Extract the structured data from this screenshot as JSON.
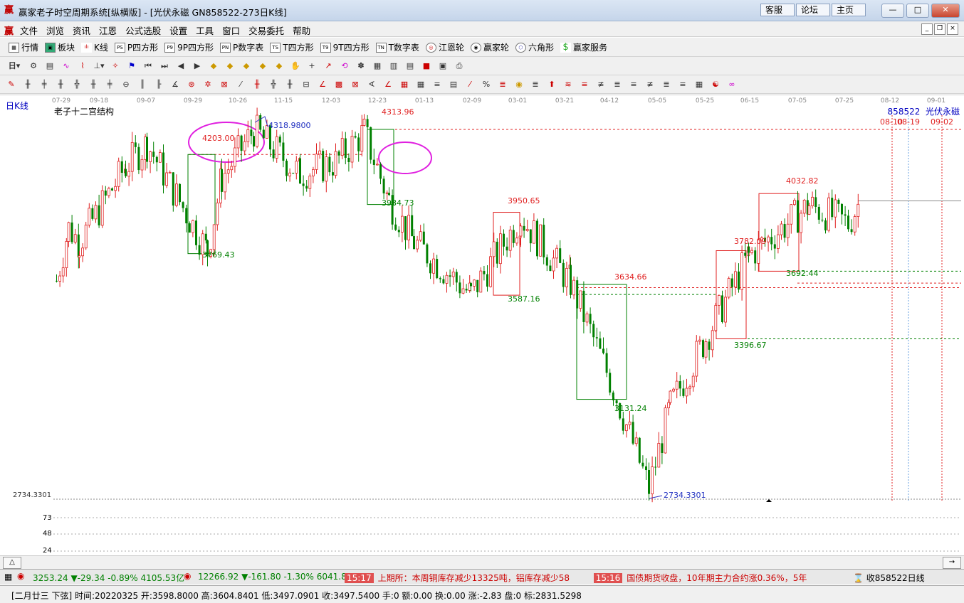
{
  "window": {
    "title": "赢家老子时空周期系统[纵横版] - [光伏永磁  GN858522-273日K线]",
    "links": [
      "客服",
      "论坛",
      "主页"
    ],
    "controls": [
      "—",
      "□",
      "✕"
    ]
  },
  "menu": [
    "文件",
    "浏览",
    "资讯",
    "江恩",
    "公式选股",
    "设置",
    "工具",
    "窗口",
    "交易委托",
    "帮助"
  ],
  "toolbar1": [
    "行情",
    "板块",
    "K线",
    "P四方形",
    "9P四方形",
    "P数字表",
    "T四方形",
    "9T四方形",
    "T数字表",
    "江恩轮",
    "赢家轮",
    "六角形",
    "赢家服务"
  ],
  "toolbar1_icons": [
    "PS",
    "P9",
    "PN",
    "TS",
    "T9",
    "TN"
  ],
  "toolbar2_period": "日",
  "chart": {
    "period_label": "日K线",
    "indicator_label": "老子十二宫结构",
    "symbol_label": "858522  光伏永磁",
    "date_ticks": [
      "07-29",
      "09-18",
      "09-07",
      "09-29",
      "10-26",
      "11-15",
      "12-03",
      "12-23",
      "01-13",
      "02-09",
      "03-01",
      "03-21",
      "04-12",
      "05-05",
      "05-25",
      "06-15",
      "07-05",
      "07-25",
      "08-12",
      "09-01"
    ],
    "future_dates": [
      "08-10",
      "08-19",
      "09-02"
    ],
    "left_price_label": "2734.3301",
    "volume_ticks": [
      "73",
      "48",
      "24"
    ],
    "annotations": [
      {
        "text": "4318.9800",
        "color": "blue"
      },
      {
        "text": "4203.00",
        "color": "red"
      },
      {
        "text": "4313.96",
        "color": "red"
      },
      {
        "text": "3984.73",
        "color": "green"
      },
      {
        "text": "3769.43",
        "color": "green"
      },
      {
        "text": "3950.65",
        "color": "red"
      },
      {
        "text": "3587.16",
        "color": "green"
      },
      {
        "text": "3634.66",
        "color": "red"
      },
      {
        "text": "3131.24",
        "color": "green"
      },
      {
        "text": "2734.3301",
        "color": "blue"
      },
      {
        "text": "3782.09",
        "color": "red"
      },
      {
        "text": "3396.67",
        "color": "green"
      },
      {
        "text": "4032.82",
        "color": "red"
      },
      {
        "text": "3692.44",
        "color": "green"
      }
    ]
  },
  "chart_data": {
    "type": "candlestick",
    "xlabel": "",
    "ylabel": "",
    "ylim": [
      2700,
      4400
    ],
    "x_ticks": [
      "07-29",
      "09-18",
      "09-07",
      "09-29",
      "10-26",
      "11-15",
      "12-03",
      "12-23",
      "01-13",
      "02-09",
      "03-01",
      "03-21",
      "04-12",
      "05-05",
      "05-25",
      "06-15",
      "07-05",
      "07-25",
      "08-12",
      "09-01"
    ],
    "close_path": [
      {
        "x": "07-29",
        "y": 3650
      },
      {
        "x": "08-10",
        "y": 3880
      },
      {
        "x": "08-25",
        "y": 3820
      },
      {
        "x": "09-07",
        "y": 4150
      },
      {
        "x": "09-18",
        "y": 4250
      },
      {
        "x": "09-29",
        "y": 3780
      },
      {
        "x": "10-12",
        "y": 4100
      },
      {
        "x": "10-26",
        "y": 4310
      },
      {
        "x": "11-15",
        "y": 4120
      },
      {
        "x": "12-03",
        "y": 4170
      },
      {
        "x": "12-23",
        "y": 4300
      },
      {
        "x": "12-30",
        "y": 4000
      },
      {
        "x": "01-13",
        "y": 3820
      },
      {
        "x": "02-09",
        "y": 3590
      },
      {
        "x": "03-01",
        "y": 3930
      },
      {
        "x": "03-21",
        "y": 3640
      },
      {
        "x": "04-12",
        "y": 3180
      },
      {
        "x": "04-27",
        "y": 2740
      },
      {
        "x": "05-05",
        "y": 3100
      },
      {
        "x": "05-25",
        "y": 3400
      },
      {
        "x": "06-15",
        "y": 3760
      },
      {
        "x": "07-05",
        "y": 3980
      },
      {
        "x": "07-25",
        "y": 3900
      },
      {
        "x": "07-29",
        "y": 3990
      }
    ]
  },
  "status": {
    "sh_index": "3253.24",
    "sh_change": "▼-29.34",
    "sh_pct": "-0.89%",
    "sh_amount": "4105.53亿",
    "sz_index": "12266.92",
    "sz_change": "▼-161.80",
    "sz_pct": "-1.30%",
    "sz_amount": "6041.8",
    "news1_time": "15:17",
    "news1_text": "上期所：本周铜库存减少13325吨，铝库存减少58",
    "news2_time": "15:16",
    "news2_text": "国债期货收盘，10年期主力合约涨0.36%，5年",
    "right_text": "收858522日线"
  },
  "info_bar": "[二月廿三  下弦] 时间:20220325 开:3598.8000 高:3604.8401 低:3497.0901 收:3497.5400 手:0 额:0.00 换:0.00 涨:-2.83 盘:0 标:2831.5298",
  "scroll": [
    "△",
    "→"
  ]
}
